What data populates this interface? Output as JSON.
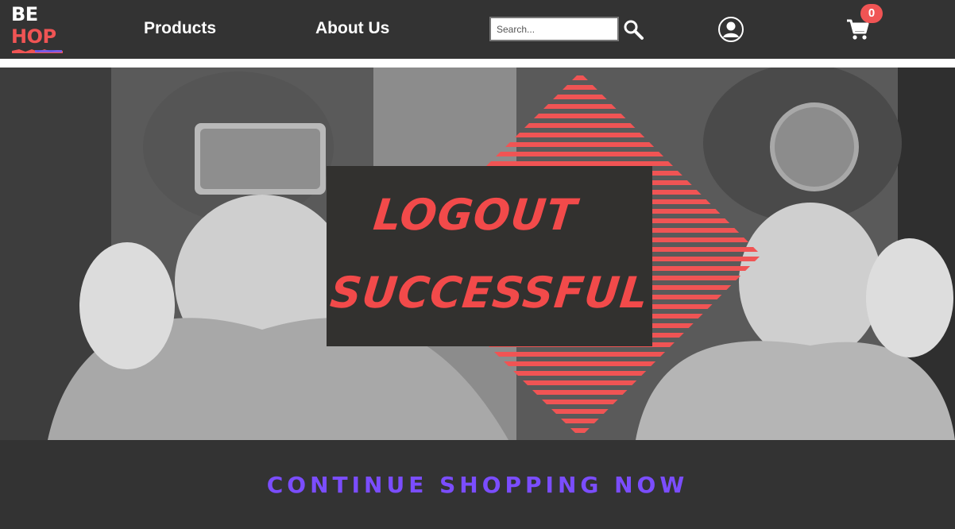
{
  "brand": {
    "line1": "BE",
    "line2": "HOP"
  },
  "nav": {
    "products": "Products",
    "about": "About Us"
  },
  "search": {
    "placeholder": "Search..."
  },
  "cart": {
    "count": "0"
  },
  "hero": {
    "message_line1": "LOGOUT",
    "message_line2": "SUCCESSFUL"
  },
  "cta": {
    "label": "CONTINUE SHOPPING NOW"
  },
  "colors": {
    "accent": "#f05454",
    "cta": "#7b4dff",
    "background": "#333333"
  },
  "icons": {
    "search": "search-icon",
    "account": "account-icon",
    "cart": "cart-icon"
  }
}
